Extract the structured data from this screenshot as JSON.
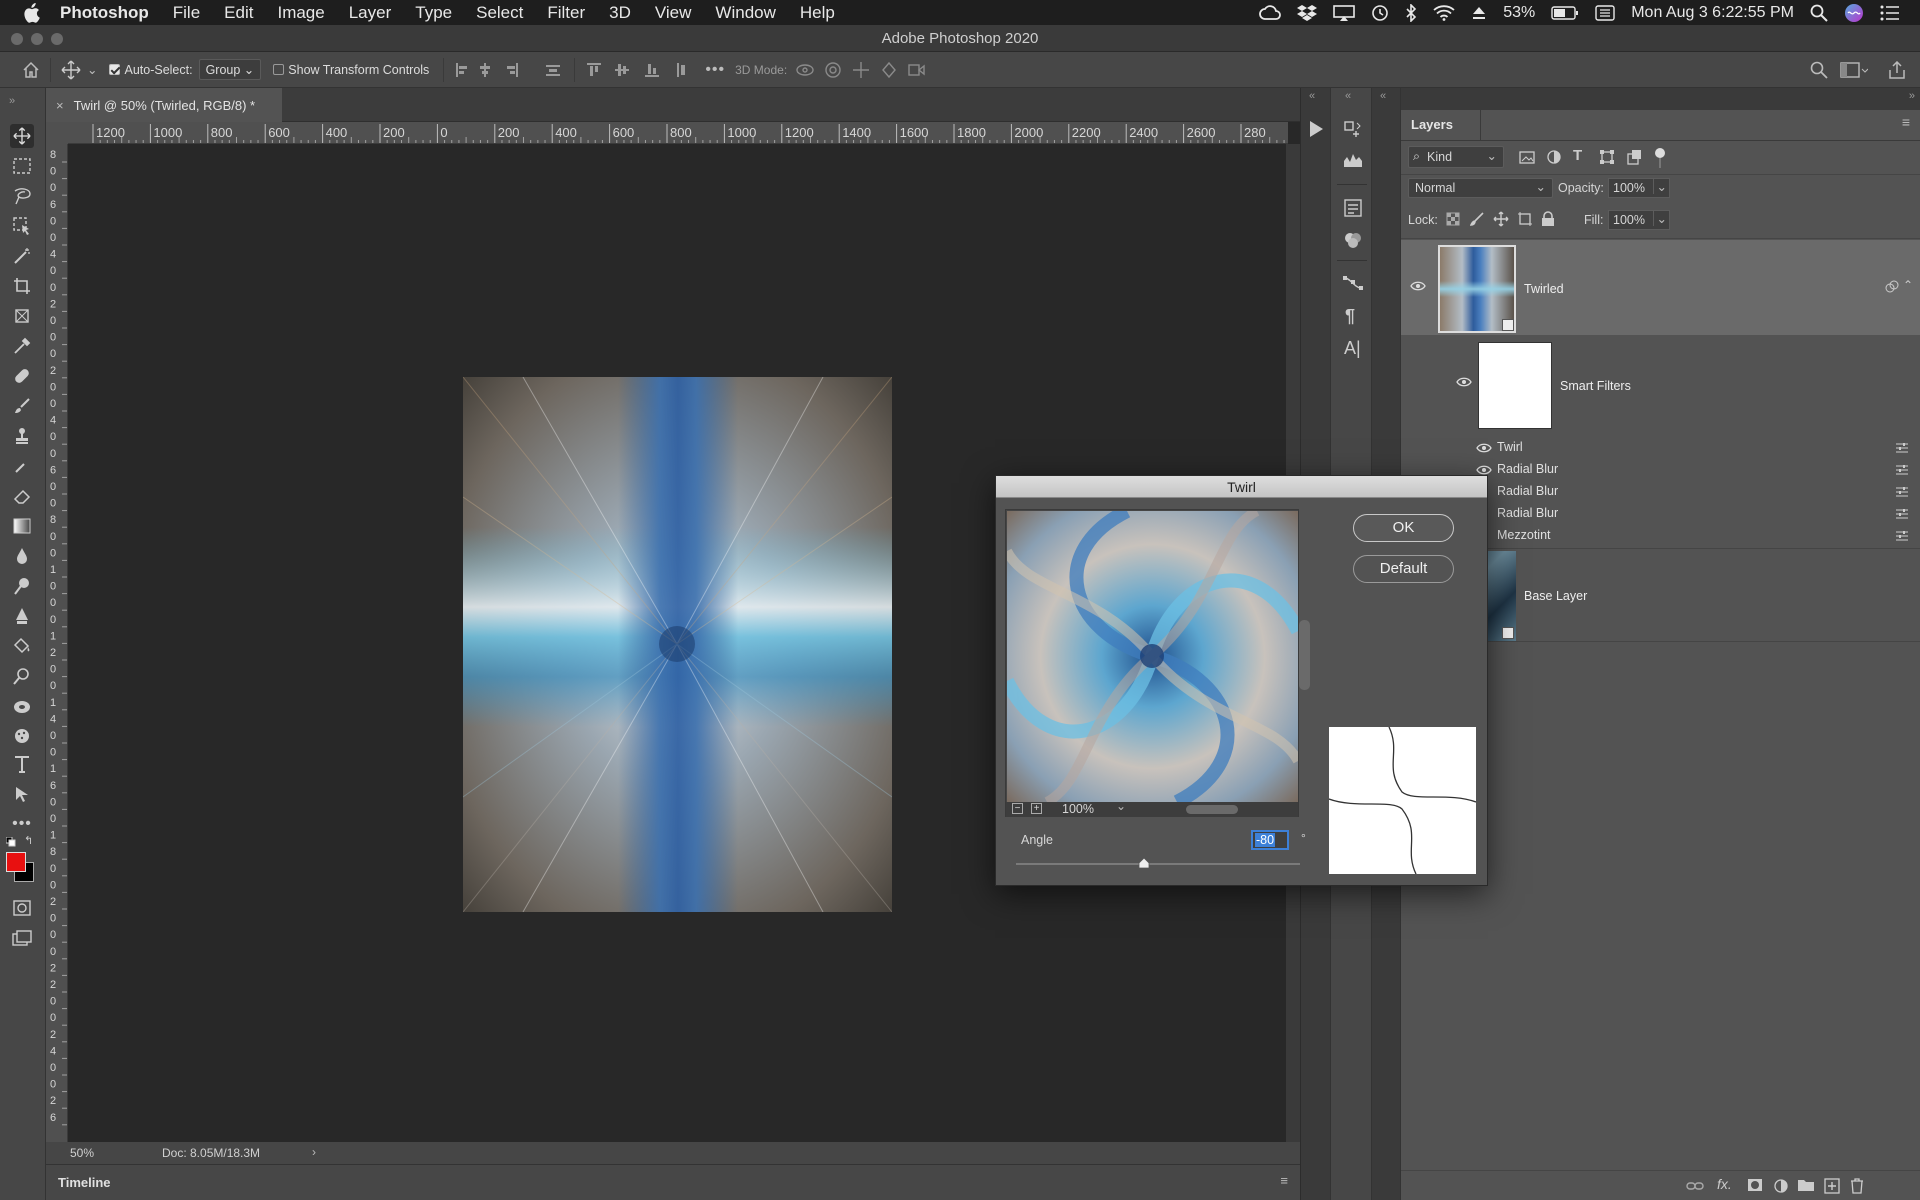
{
  "menubar": {
    "app": "Photoshop",
    "items": [
      "File",
      "Edit",
      "Image",
      "Layer",
      "Type",
      "Select",
      "Filter",
      "3D",
      "View",
      "Window",
      "Help"
    ],
    "battery": "53%",
    "datetime": "Mon Aug 3  6:22:55 PM"
  },
  "window": {
    "title": "Adobe Photoshop 2020"
  },
  "options": {
    "auto_select_label": "Auto-Select:",
    "auto_select_value": "Group",
    "show_transform_label": "Show Transform Controls",
    "mode_3d_label": "3D Mode:"
  },
  "document": {
    "tab_title": "Twirl @ 50% (Twirled, RGB/8) *",
    "zoom": "50%",
    "doc_info": "Doc: 8.05M/18.3M",
    "ruler_h": [
      "1200",
      "1000",
      "800",
      "600",
      "400",
      "200",
      "0",
      "200",
      "400",
      "600",
      "800",
      "1000",
      "1200",
      "1400",
      "1600",
      "1800",
      "2000",
      "2200",
      "2400",
      "2600",
      "280"
    ],
    "ruler_v": [
      "8",
      "0",
      "0",
      "6",
      "0",
      "0",
      "4",
      "0",
      "0",
      "2",
      "0",
      "0",
      "0",
      "2",
      "0",
      "0",
      "4",
      "0",
      "0",
      "6",
      "0",
      "0",
      "8",
      "0",
      "0",
      "1",
      "0",
      "0",
      "0",
      "1",
      "2",
      "0",
      "0",
      "1",
      "4",
      "0",
      "0",
      "1",
      "6",
      "0",
      "0",
      "1",
      "8",
      "0",
      "0",
      "2",
      "0",
      "0",
      "0",
      "2",
      "2",
      "0",
      "0",
      "2",
      "4",
      "0",
      "0",
      "2",
      "6"
    ]
  },
  "timeline": {
    "label": "Timeline"
  },
  "layers_panel": {
    "title": "Layers",
    "kind_filter": "Kind",
    "blend_mode": "Normal",
    "opacity_label": "Opacity:",
    "opacity_value": "100%",
    "lock_label": "Lock:",
    "fill_label": "Fill:",
    "fill_value": "100%",
    "layers": [
      {
        "name": "Twirled"
      },
      {
        "name": "Smart Filters"
      },
      {
        "name": "Base Layer"
      }
    ],
    "filters": [
      "Twirl",
      "Radial Blur",
      "Radial Blur",
      "Radial Blur",
      "Mezzotint"
    ]
  },
  "dialog": {
    "title": "Twirl",
    "ok_label": "OK",
    "default_label": "Default",
    "preview_zoom": "100%",
    "angle_label": "Angle",
    "angle_value": "-80",
    "degree_symbol": "°",
    "angle_fraction": 0.45
  },
  "colors": {
    "foreground": "#e81010",
    "background": "#000000"
  }
}
